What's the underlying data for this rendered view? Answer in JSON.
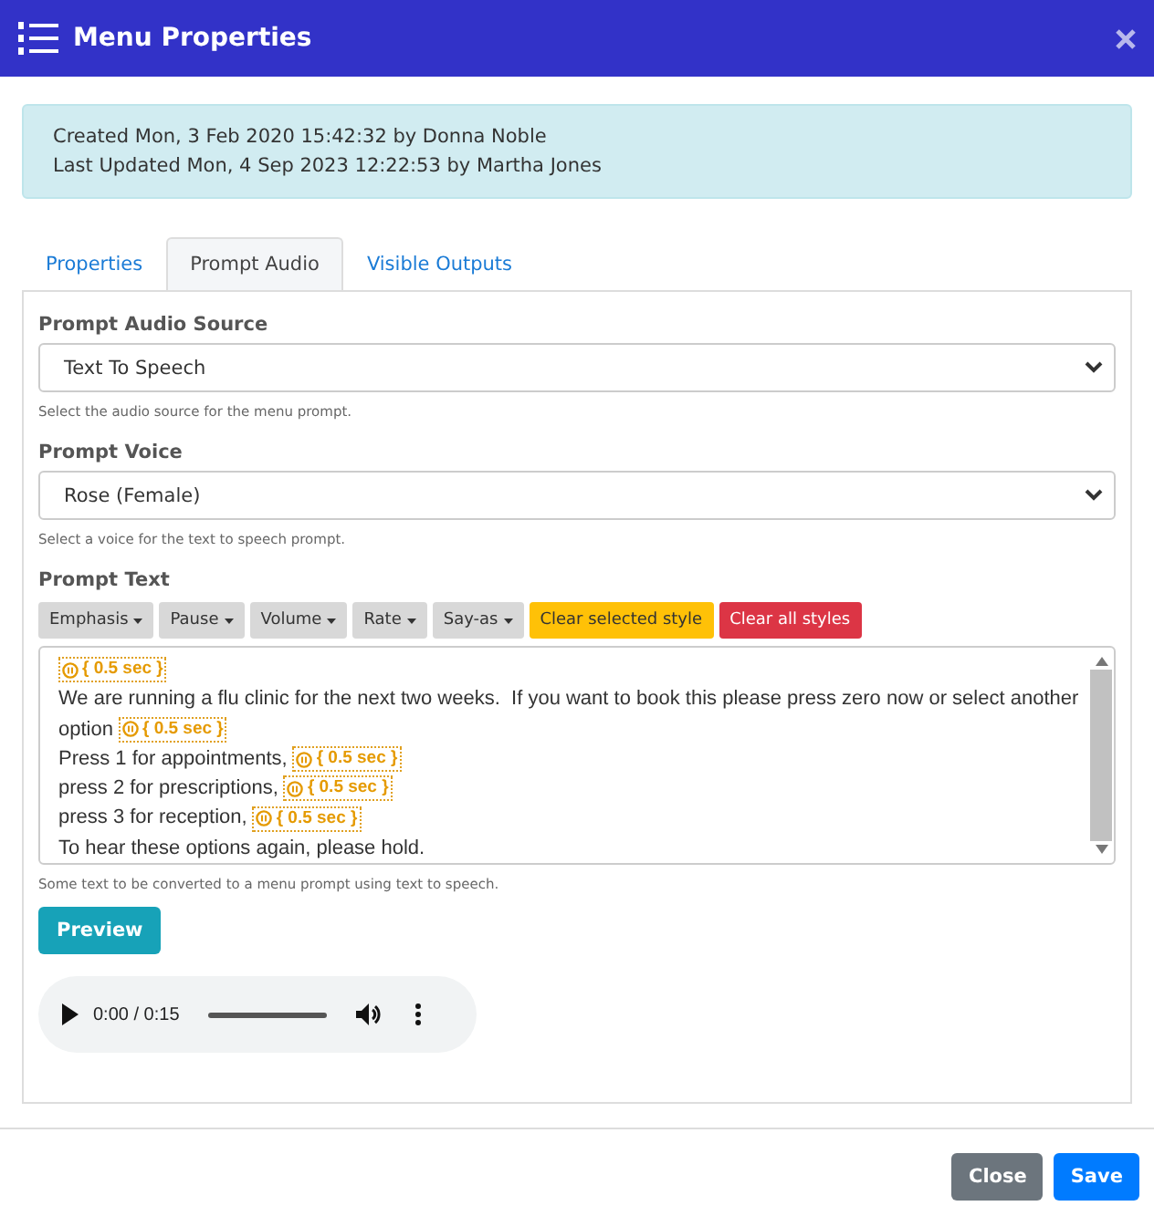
{
  "window": {
    "title": "Menu Properties"
  },
  "info": [
    "Created Mon, 3 Feb 2020 15:42:32 by Donna Noble",
    "Last Updated Mon, 4 Sep 2023 12:22:53 by Martha Jones"
  ],
  "tabs": [
    {
      "label": "Properties",
      "selected": false
    },
    {
      "label": "Prompt Audio",
      "selected": true
    },
    {
      "label": "Visible Outputs",
      "selected": false
    }
  ],
  "fields": [
    {
      "label": "Prompt Audio Source",
      "value": "Text To Speech",
      "help": "Select the audio source for the menu prompt."
    },
    {
      "label": "Prompt Voice",
      "value": "Rose (Female)",
      "help": "Select a voice for the text to speech prompt."
    }
  ],
  "prompt_text": {
    "label": "Prompt Text",
    "toolbar": [
      {
        "label": "Emphasis",
        "kind": "menu"
      },
      {
        "label": "Pause",
        "kind": "menu"
      },
      {
        "label": "Volume",
        "kind": "menu"
      },
      {
        "label": "Rate",
        "kind": "menu"
      },
      {
        "label": "Say-as",
        "kind": "menu"
      },
      {
        "label": "Clear selected style",
        "kind": "warning"
      },
      {
        "label": "Clear all styles",
        "kind": "danger"
      }
    ],
    "lines": [
      [
        {
          "kind": "pause",
          "text": "{ 0.5 sec }"
        }
      ],
      [
        {
          "kind": "text",
          "text": "We are running a flu clinic for the next two weeks.  If you want to book this please press zero now or select another"
        }
      ],
      [
        {
          "kind": "text",
          "text": "option"
        },
        {
          "kind": "pause",
          "text": "{ 0.5 sec }"
        }
      ],
      [
        {
          "kind": "text",
          "text": "Press 1 for appointments,"
        },
        {
          "kind": "pause",
          "text": "{ 0.5 sec }"
        }
      ],
      [
        {
          "kind": "text",
          "text": "press 2 for prescriptions,"
        },
        {
          "kind": "pause",
          "text": "{ 0.5 sec }"
        }
      ],
      [
        {
          "kind": "text",
          "text": "press 3 for reception,"
        },
        {
          "kind": "pause",
          "text": "{ 0.5 sec }"
        }
      ],
      [
        {
          "kind": "text",
          "text": "To hear these options again, please hold."
        }
      ]
    ],
    "help": "Some text to be converted to a menu prompt using text to speech."
  },
  "preview_button": "Preview",
  "audio": {
    "time": "0:00 / 0:15"
  },
  "footer_buttons": [
    {
      "label": "Close",
      "kind": "secondary"
    },
    {
      "label": "Save",
      "kind": "primary"
    }
  ]
}
